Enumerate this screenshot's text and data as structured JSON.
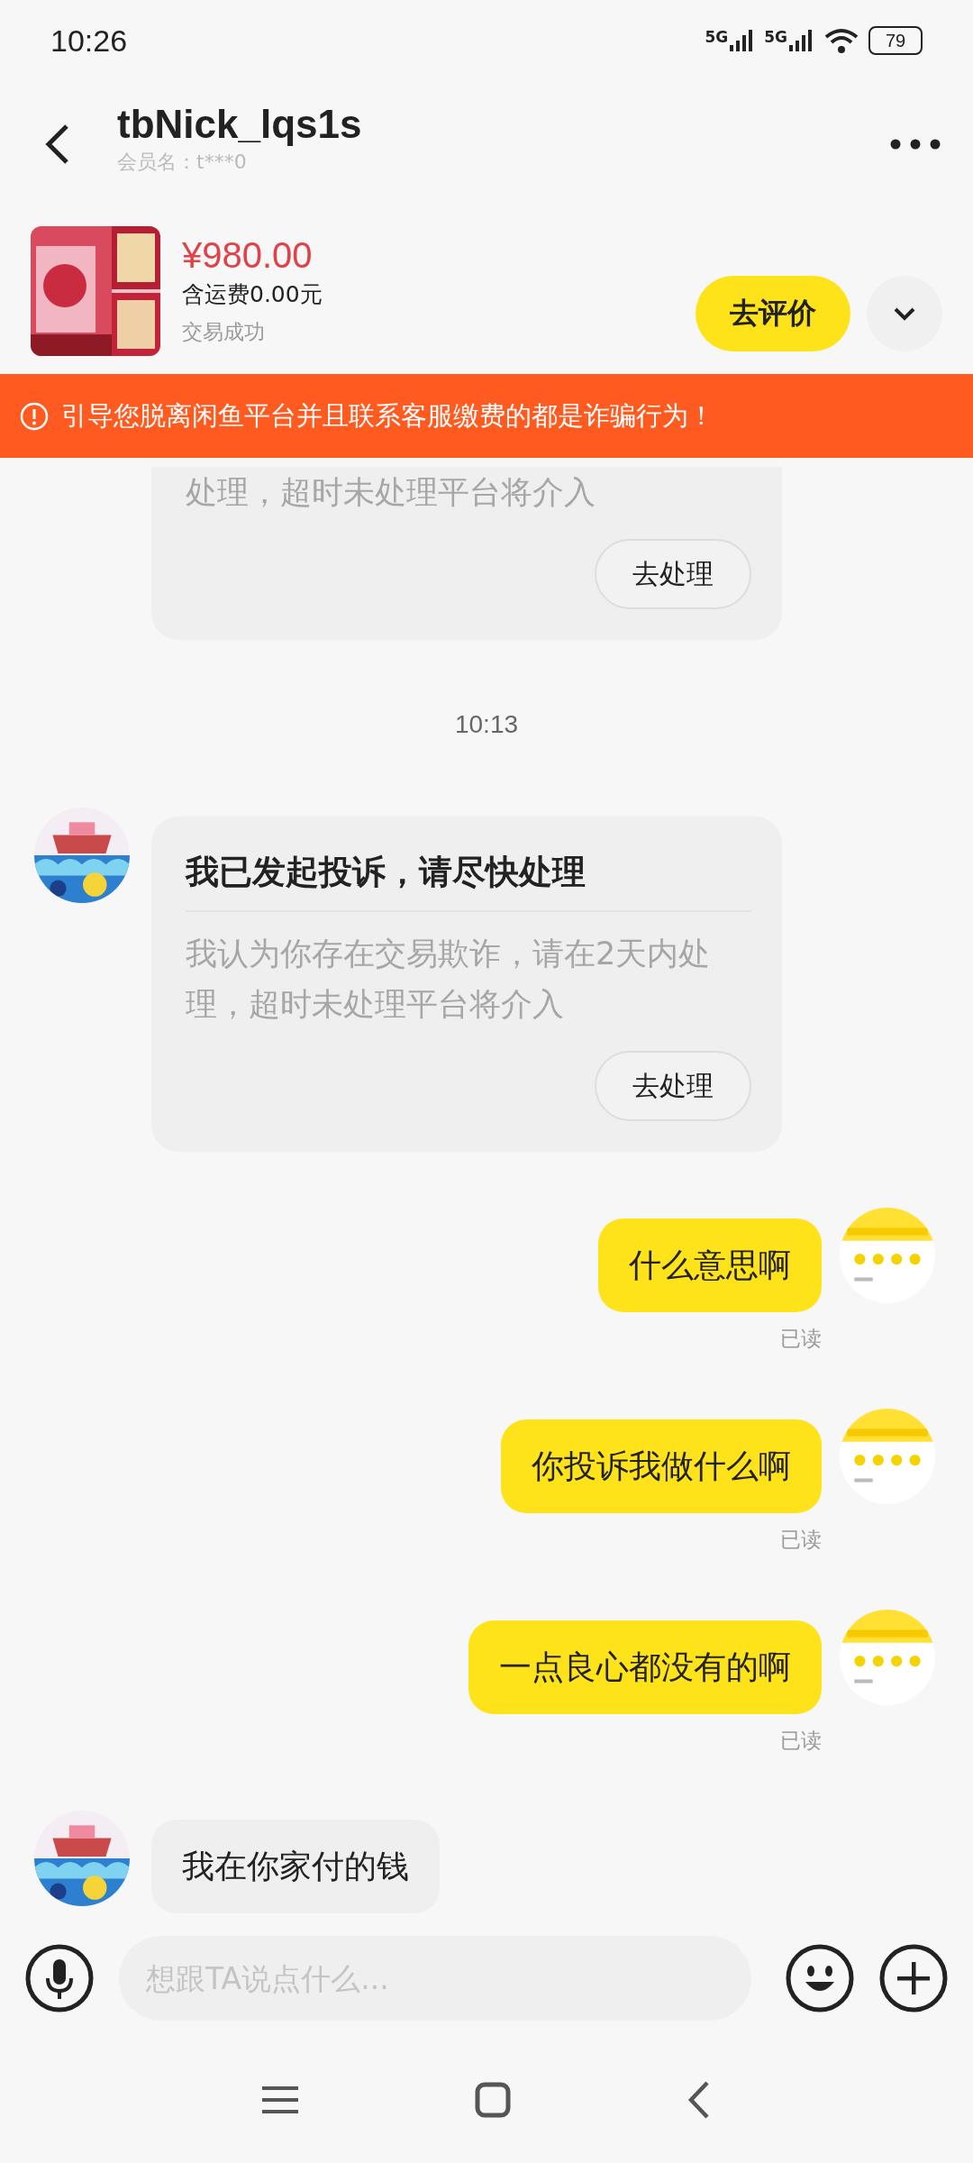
{
  "status_bar": {
    "time": "10:26",
    "networks": [
      "5G",
      "5G"
    ],
    "battery": "79"
  },
  "header": {
    "title": "tbNick_lqs1s",
    "subtitle": "会员名：t***0"
  },
  "product": {
    "price": "¥980.00",
    "shipping": "含运费0.00元",
    "status": "交易成功",
    "action": "去评价"
  },
  "warning": {
    "text": "引导您脱离闲鱼平台并且联系客服缴费的都是诈骗行为！"
  },
  "messages": [
    {
      "kind": "card",
      "outgoing": false,
      "avatar": false,
      "body": "处理，超时未处理平台将介入",
      "button": "去处理"
    },
    {
      "kind": "time",
      "text": "10:13"
    },
    {
      "kind": "card",
      "outgoing": false,
      "avatar": true,
      "title": "我已发起投诉，请尽快处理",
      "body": "我认为你存在交易欺诈，请在2天内处理，超时未处理平台将介入",
      "button": "去处理"
    },
    {
      "kind": "text",
      "outgoing": true,
      "avatar": true,
      "text": "什么意思啊",
      "receipt": "已读"
    },
    {
      "kind": "text",
      "outgoing": true,
      "avatar": true,
      "text": "你投诉我做什么啊",
      "receipt": "已读"
    },
    {
      "kind": "text",
      "outgoing": true,
      "avatar": true,
      "text": "一点良心都没有的啊",
      "receipt": "已读"
    },
    {
      "kind": "text",
      "outgoing": false,
      "avatar": true,
      "text": "我在你家付的钱"
    }
  ],
  "composer": {
    "placeholder": "想跟TA说点什么..."
  }
}
